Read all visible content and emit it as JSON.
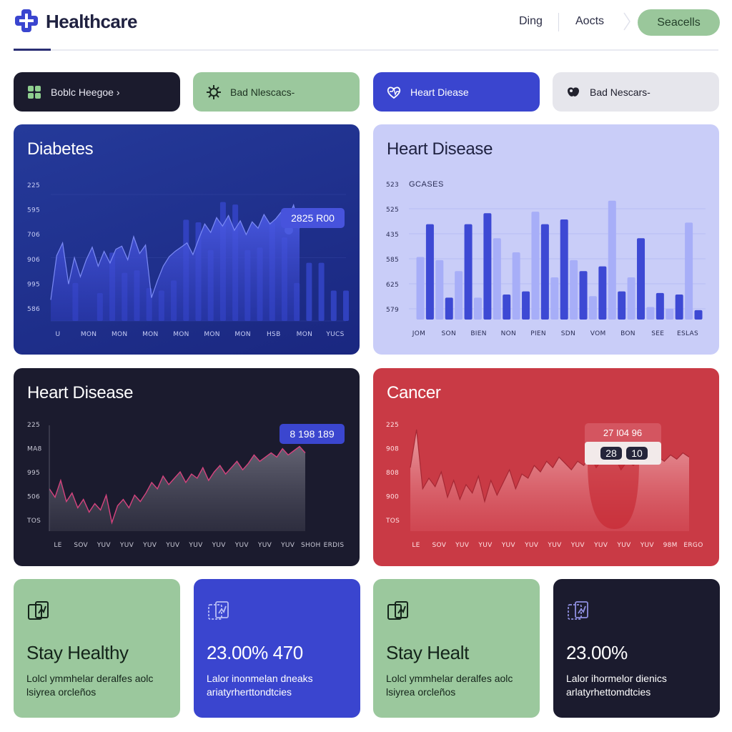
{
  "header": {
    "brand": "Healthcare",
    "nav": [
      "Ding",
      "Aocts"
    ],
    "cta_label": "Seacells",
    "colors": {
      "brand": "#3a45cf",
      "cta": "#9ac79b"
    }
  },
  "categories": [
    {
      "label": "Boblc Heegoe ›",
      "icon": "grid-icon"
    },
    {
      "label": "Bad Nlescacs-",
      "icon": "virus-icon"
    },
    {
      "label": "Heart Diease",
      "icon": "heart-icon"
    },
    {
      "label": "Bad Nescars-",
      "icon": "organ-icon"
    }
  ],
  "panels": {
    "diabetes": {
      "title": "Diabetes",
      "badge": "2825 R00"
    },
    "heart_bar": {
      "title": "Heart Disease",
      "series_name": "GCASES"
    },
    "heart_line": {
      "title": "Heart Disease",
      "badge": "8 198 189"
    },
    "cancer": {
      "title": "Cancer",
      "badge_top": "27 I04 96",
      "badge_a": "28",
      "badge_b": "10"
    }
  },
  "chart_data": [
    {
      "type": "area",
      "title": "Diabetes",
      "ytick_labels": [
        "225",
        "595",
        "706",
        "906",
        "995",
        "586"
      ],
      "xtick_labels": [
        "U",
        "MON",
        "MON",
        "MON",
        "MON",
        "MON",
        "MON",
        "HSB",
        "MON",
        "YUCS"
      ],
      "series": [
        {
          "values": [
            20,
            62,
            74,
            35,
            60,
            42,
            58,
            70,
            52,
            66,
            55,
            68,
            71,
            58,
            80,
            64,
            72,
            22,
            38,
            52,
            61,
            66,
            70,
            74,
            63,
            78,
            92,
            84,
            98,
            90,
            100,
            86,
            95,
            82,
            94,
            88,
            101,
            92,
            97,
            104,
            96,
            110,
            88
          ]
        }
      ],
      "bars": [
        0,
        0,
        1.5,
        0,
        1.1,
        2.7,
        1.9,
        2,
        1.3,
        1.2,
        1.6,
        4,
        3.9,
        2.8,
        4.7,
        4.6,
        2.8,
        2.9,
        3.9,
        3.3,
        1.5,
        2.3,
        2.3,
        1.2,
        1.2
      ]
    },
    {
      "type": "bar",
      "title": "Heart Disease",
      "ytick_labels": [
        "523",
        "525",
        "435",
        "585",
        "625",
        "579"
      ],
      "xtick_labels": [
        "JOM",
        "SON",
        "BIEN",
        "NON",
        "PIEN",
        "SDN",
        "VOM",
        "BON",
        "SEE",
        "ESLAS"
      ],
      "series": [
        {
          "name": "GCASES",
          "values": [
            2,
            3.05,
            1.9,
            0.7,
            1.55,
            3.05,
            0.7,
            3.4,
            2.6,
            0.8,
            2.15,
            0.9,
            3.45,
            3.05,
            1.35,
            3.2,
            1.9,
            1.55,
            0.75,
            1.7,
            3.8,
            0.9,
            1.35,
            2.6,
            0.4,
            0.85,
            0.35,
            0.8,
            3.1,
            0.3
          ]
        }
      ]
    },
    {
      "type": "line",
      "title": "Heart Disease",
      "ytick_labels": [
        "225",
        "MA8",
        "995",
        "506",
        "TOS"
      ],
      "xtick_labels": [
        "LE",
        "SOV",
        "YUV",
        "YUV",
        "YUV",
        "YUV",
        "YUV",
        "YUV",
        "YUV",
        "YUV",
        "YUV",
        "SHOH",
        "ERDIS"
      ],
      "series": [
        {
          "values": [
            40,
            32,
            48,
            28,
            36,
            22,
            30,
            18,
            26,
            20,
            34,
            8,
            24,
            30,
            22,
            34,
            28,
            36,
            46,
            40,
            52,
            44,
            50,
            56,
            46,
            54,
            50,
            60,
            48,
            56,
            62,
            54,
            60,
            66,
            58,
            64,
            72,
            66,
            70,
            74,
            70,
            78,
            72,
            76,
            80,
            74
          ]
        }
      ]
    },
    {
      "type": "line",
      "title": "Cancer",
      "ytick_labels": [
        "225",
        "908",
        "808",
        "900",
        "TOS"
      ],
      "xtick_labels": [
        "LE",
        "SOV",
        "YUV",
        "YUV",
        "YUV",
        "YUV",
        "YUV",
        "YUV",
        "YUV",
        "YUV",
        "YUV",
        "98M",
        "ERGO"
      ],
      "series": [
        {
          "values": [
            60,
            96,
            40,
            50,
            42,
            56,
            32,
            48,
            30,
            44,
            36,
            52,
            28,
            48,
            34,
            46,
            58,
            40,
            54,
            50,
            62,
            56,
            66,
            60,
            70,
            64,
            58,
            66,
            62,
            72,
            60,
            68,
            64,
            70,
            58,
            66,
            62,
            68,
            72,
            64,
            70,
            66,
            72,
            68,
            74,
            70
          ]
        }
      ]
    }
  ],
  "stats": [
    {
      "value": "Stay Healthy",
      "desc": "Lolcl ymmhelar deralfes aolc lsiyrea orcleños"
    },
    {
      "value": "23.00% 470",
      "desc": "Lalor inonmelan dneaks ariatyrherttondtcies"
    },
    {
      "value": "Stay Healt",
      "desc": "Lolcl ymmhelar deralfes aolc lsiyrea orcleños"
    },
    {
      "value": "23.00%",
      "desc": "Lalor ihormelor dienics arlatyrhettomdtcies"
    }
  ]
}
